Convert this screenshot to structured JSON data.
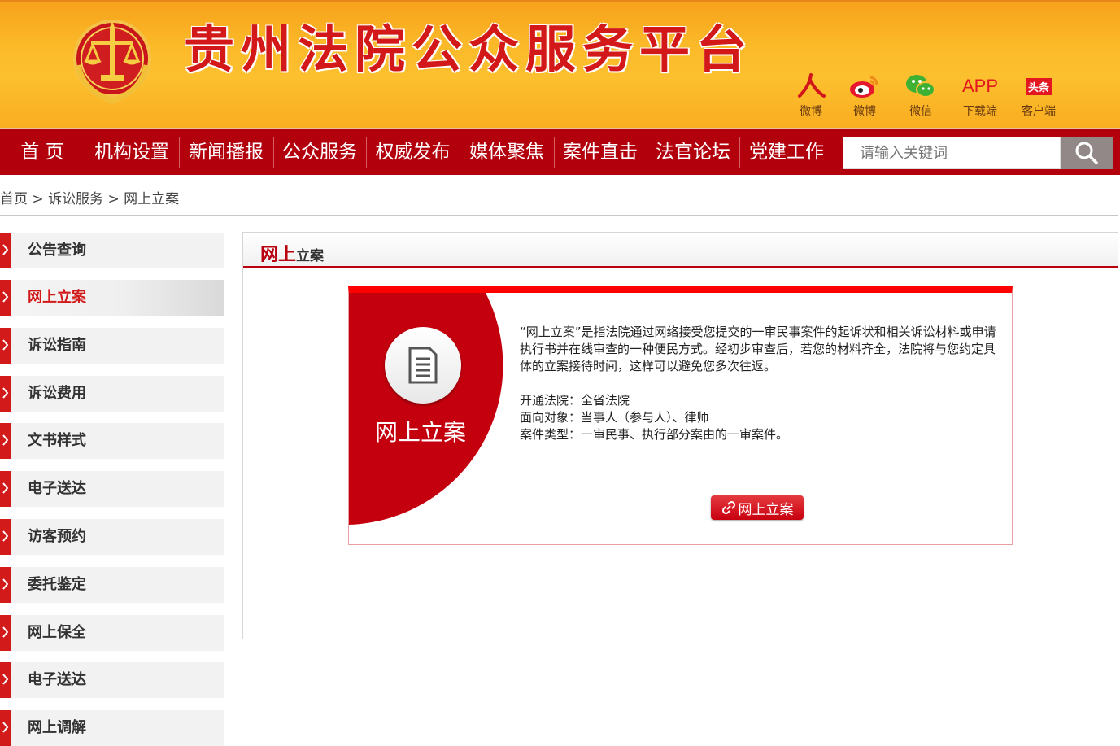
{
  "header": {
    "site_title": "贵州法院公众服务平台",
    "social": [
      {
        "label": "微博",
        "icon": "renmin-weibo-icon"
      },
      {
        "label": "微博",
        "icon": "sina-weibo-icon"
      },
      {
        "label": "微信",
        "icon": "wechat-icon"
      },
      {
        "label": "下载端",
        "icon": "app-icon",
        "icon_text": "APP"
      },
      {
        "label": "客户端",
        "icon": "toutiao-icon",
        "icon_text": "头条"
      }
    ]
  },
  "nav": {
    "items": [
      "首 页",
      "机构设置",
      "新闻播报",
      "公众服务",
      "权威发布",
      "媒体聚焦",
      "案件直击",
      "法官论坛",
      "党建工作"
    ],
    "search_placeholder": "请输入关键词"
  },
  "breadcrumb": {
    "items": [
      "首页",
      "诉讼服务",
      "网上立案"
    ],
    "separator": ">"
  },
  "sidebar": {
    "items": [
      "公告查询",
      "网上立案",
      "诉讼指南",
      "诉讼费用",
      "文书样式",
      "电子送达",
      "访客预约",
      "委托鉴定",
      "网上保全",
      "电子送达",
      "网上调解"
    ],
    "active_index": 1
  },
  "panel": {
    "title_major": "网上",
    "title_minor": "立案"
  },
  "card": {
    "label": "网上立案",
    "intro": "“网上立案”是指法院通过网络接受您提交的一审民事案件的起诉状和相关诉讼材料或申请执行书并在线审查的一种便民方式。经初步审查后，若您的材料齐全，法院将与您约定具体的立案接待时间，这样可以避免您多次往返。",
    "court": "开通法院：全省法院",
    "audience": "面向对象：当事人（参与人）、律师",
    "case_types": "案件类型：一审民事、执行部分案由的一审案件。",
    "button_label": "网上立案"
  },
  "colors": {
    "brand_red": "#b3000d",
    "accent_red": "#d21a1a",
    "header_gold": "#fbb928"
  }
}
